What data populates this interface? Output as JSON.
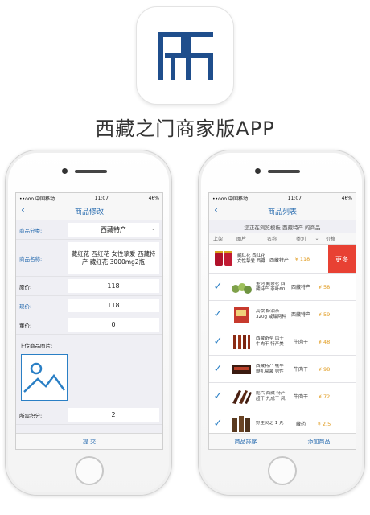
{
  "app_title": "西藏之门商家版APP",
  "colors": {
    "accent": "#2a6db0",
    "price": "#e09a1c",
    "more": "#e84133"
  },
  "status": {
    "carrier": "••ooo 中国移动",
    "time": "11:07",
    "battery": "46%"
  },
  "edit_screen": {
    "nav_title": "商品修改",
    "category_label": "商品分类:",
    "category_value": "西藏特产",
    "name_label": "商品名称:",
    "name_value": "藏红花 西红花 女性挚爱 西藏特产 藏红花 3000mg2瓶",
    "original_price_label": "原价:",
    "original_price": "118",
    "current_price_label": "现价:",
    "current_price": "118",
    "member_price_label": "董价:",
    "member_price": "0",
    "upload_label": "上传商品图片:",
    "points_label": "所需积分:",
    "points_value": "2",
    "submit_label": "提 交"
  },
  "list_screen": {
    "nav_title": "商品列表",
    "browse_note": "您正在浏览模板 西藏特产 的商品",
    "columns": {
      "shelf": "上架",
      "image": "图片",
      "name": "名称",
      "category": "类別",
      "price": "价格"
    },
    "swipe_row": {
      "name": "藏红花 西红花 女性挚爱 西藏",
      "category": "西藏特产",
      "price": "¥ 118",
      "more": "更多"
    },
    "rows": [
      {
        "name": "金诃 藏茶花 西藏特产 茶叶60",
        "category": "西藏特产",
        "price": "¥ 58"
      },
      {
        "name": "高饮 酥油茶320g 咸甜两种",
        "category": "西藏特产",
        "price": "¥ 59"
      },
      {
        "name": "西藏奇圣 风干 牛肉干 特产美",
        "category": "牛肉干",
        "price": "¥ 48"
      },
      {
        "name": "西藏特产 牦牛鞭礼盒装 男性",
        "category": "牛肉干",
        "price": "¥ 98"
      },
      {
        "name": "彪六 西藏 特产超干 九成干 风",
        "category": "牛肉干",
        "price": "¥ 72"
      },
      {
        "name": "野生灵芝 1 克",
        "category": "藏药",
        "price": "¥ 2.5"
      }
    ],
    "sort_label": "商品排序",
    "add_label": "添加商品"
  }
}
